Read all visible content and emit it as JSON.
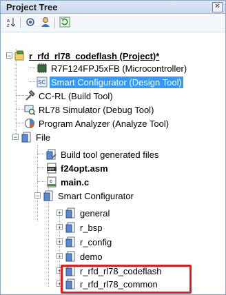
{
  "panel": {
    "title": "Project Tree",
    "close_glyph": "✕"
  },
  "toolbar": {
    "buttons": [
      "sort-icon",
      "settings-icon",
      "user-icon",
      "refresh-icon"
    ]
  },
  "tree": {
    "project": "r_rfd_rl78_codeflash (Project)*",
    "microcontroller": "R7F124FPJ5xFB (Microcontroller)",
    "smart_configurator_tool": "Smart Configurator (Design Tool)",
    "build_tool": "CC-RL (Build Tool)",
    "debug_tool": "RL78 Simulator (Debug Tool)",
    "analyze_tool": "Program Analyzer (Analyze Tool)",
    "file_folder": "File",
    "build_generated": "Build tool generated files",
    "f24opt": "f24opt.asm",
    "main_c": "main.c",
    "sc_folder": "Smart Configurator",
    "general": "general",
    "r_bsp": "r_bsp",
    "r_config": "r_config",
    "demo": "demo",
    "codeflash": "r_rfd_rl78_codeflash",
    "common": "r_rfd_rl78_common"
  },
  "colors": {
    "selection": "#3399ff",
    "highlight": "#e8191c"
  }
}
